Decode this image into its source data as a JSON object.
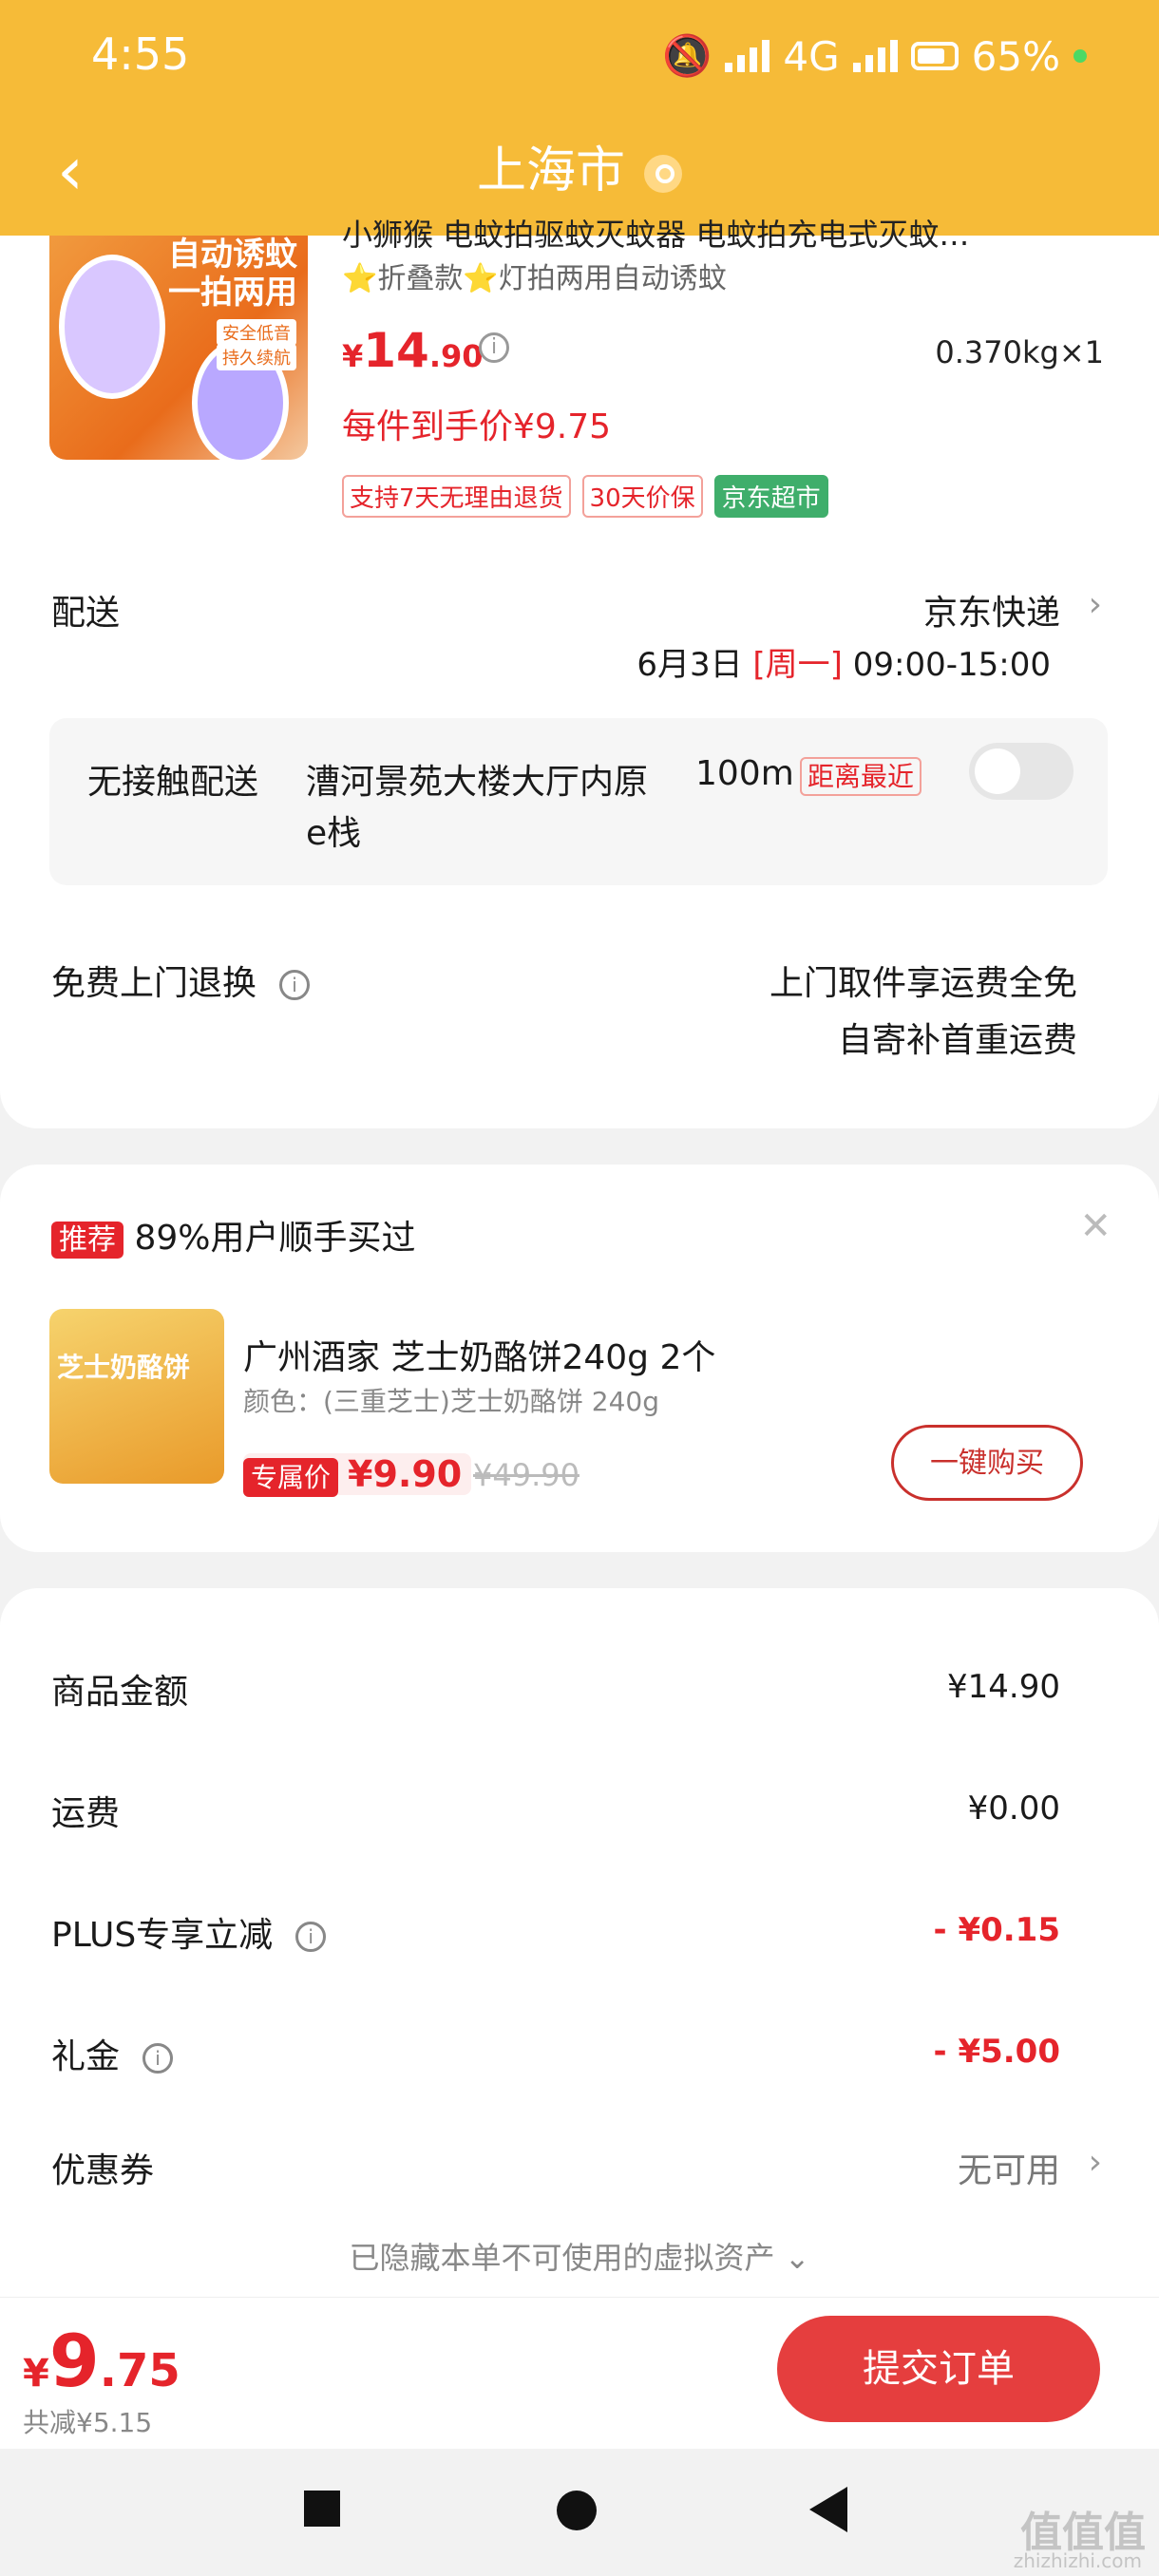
{
  "status_bar": {
    "time": "4:55",
    "network": "4G",
    "battery": "65%"
  },
  "header": {
    "title": "上海市"
  },
  "product": {
    "title": "小狮猴 电蚊拍驱蚊灭蚊器 电蚊拍充电式灭蚊…",
    "subtitle": "⭐折叠款⭐灯拍两用自动诱蚊",
    "image_text": "自动诱蚊 一拍两用",
    "image_tag1": "安全低音",
    "image_tag2": "持久续航",
    "price_symbol": "¥",
    "price_int": "14",
    "price_dec": ".90",
    "weight": "0.370kg×1",
    "per_price": "每件到手价¥9.75",
    "tags": [
      "支持7天无理由退货",
      "30天价保",
      "京东超市"
    ]
  },
  "delivery": {
    "label": "配送",
    "carrier": "京东快递",
    "date": "6月3日",
    "weekday": "[周一]",
    "time": "09:00-15:00",
    "contactless_label": "无接触配送",
    "address": "漕河景苑大楼大厅内原",
    "address2": "e栈",
    "distance": "100m",
    "distance_badge": "距离最近"
  },
  "returns": {
    "label": "免费上门退换",
    "line1": "上门取件享运费全免",
    "line2": "自寄补首重运费"
  },
  "recommend": {
    "badge": "推荐",
    "text": "89%用户顺手买过",
    "image_text": "芝士奶酪饼",
    "name": "广州酒家 芝士奶酪饼240g 2个",
    "spec": "颜色：(三重芝士)芝士奶酪饼 240g",
    "price_label": "专属价",
    "price": "¥9.90",
    "orig_price": "¥49.90",
    "buy_button": "一键购买"
  },
  "summary": {
    "rows": [
      {
        "label": "商品金额",
        "value": "¥14.90"
      },
      {
        "label": "运费",
        "value": "¥0.00"
      },
      {
        "label": "PLUS专享立减",
        "value": "- ¥0.15"
      },
      {
        "label": "礼金",
        "value": "- ¥5.00"
      }
    ],
    "coupon_label": "优惠券",
    "coupon_value": "无可用",
    "hidden_note": "已隐藏本单不可使用的虚拟资产"
  },
  "footer": {
    "total_symbol": "¥",
    "total_int": "9",
    "total_dec": ".75",
    "saved": "共减¥5.15",
    "submit": "提交订单"
  },
  "watermark": {
    "text": "值值值",
    "url": "zhizhizhi.com"
  }
}
